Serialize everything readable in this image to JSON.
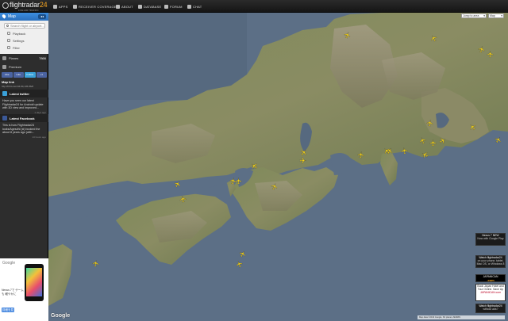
{
  "topbar": {
    "logo": {
      "brand_text": "flightradar",
      "brand_num": "24",
      "tagline": "LIVE AIR TRAFFIC"
    },
    "nav": [
      {
        "label": "APPS",
        "icon": "phone-icon"
      },
      {
        "label": "RECEIVER COVERAGE",
        "icon": "antenna-icon"
      },
      {
        "label": "ABOUT",
        "icon": "info-icon"
      },
      {
        "label": "DATABASE",
        "icon": "database-icon"
      },
      {
        "label": "FORUM",
        "icon": "forum-icon"
      },
      {
        "label": "CHAT",
        "icon": "chat-icon"
      }
    ]
  },
  "sidebar": {
    "map_tab": {
      "label": "Map"
    },
    "search": {
      "placeholder": "Search flight or airport..."
    },
    "map_menu": [
      {
        "label": "Playback"
      },
      {
        "label": "Settings"
      },
      {
        "label": "Filter"
      }
    ],
    "planes_row": {
      "label": "Planes",
      "value": "7866"
    },
    "premium_row": {
      "label": "Premium"
    },
    "social": [
      {
        "label": "Like"
      },
      {
        "label": "Like"
      },
      {
        "label": "Follow"
      },
      {
        "label": "+1"
      }
    ],
    "map_link": {
      "title": "Map link",
      "url": "http://fr24.com/34.89,135.86/8"
    },
    "twitter": {
      "title": "Latest twitter",
      "text": "Have you seen our latest Flightradar24 for Android update with 3D view and improved...",
      "ago": "1 days ago"
    },
    "facebook": {
      "title": "Latest Facebook",
      "text": "This is how Flightradar24 looks/Agesdhi (st) booked the about 8 years ago (with...",
      "ago": "13 hours ago"
    },
    "ad": {
      "brand": "Google",
      "text": "Nexus 7で ゲームも 軽やかに",
      "button": "詳細を見る"
    }
  },
  "map": {
    "controls": {
      "jump_to": "Jump to area",
      "map_type": "Map"
    },
    "google_label": "Google",
    "attribution": "Map data ©2013 Google, SK planet, ZENRIN",
    "right_ads": [
      {
        "line1": "Nexus 7 NEW",
        "line2": "Now with Google Play",
        "line3": ""
      },
      {
        "line1": "Watch flightradar24",
        "line2": "on your phone, tablet, Mac OS, or Windows 8",
        "line3": ""
      },
      {
        "line1": "JAPANICAN",
        "line2": ".com",
        "line3": ""
      },
      {
        "line1": "Book Japan Hotel and Tour Online. Save Up",
        "line2": "JAPANICAN.com",
        "line3": ""
      },
      {
        "line1": "Watch flightradar24",
        "line2": "without ads?",
        "line3": ""
      }
    ],
    "plane_count": 26
  },
  "colors": {
    "accent_blue": "#2a6fbd",
    "plane_yellow": "#f3d21a",
    "brand_orange": "#f6a623",
    "sea": "#5c6f86"
  }
}
